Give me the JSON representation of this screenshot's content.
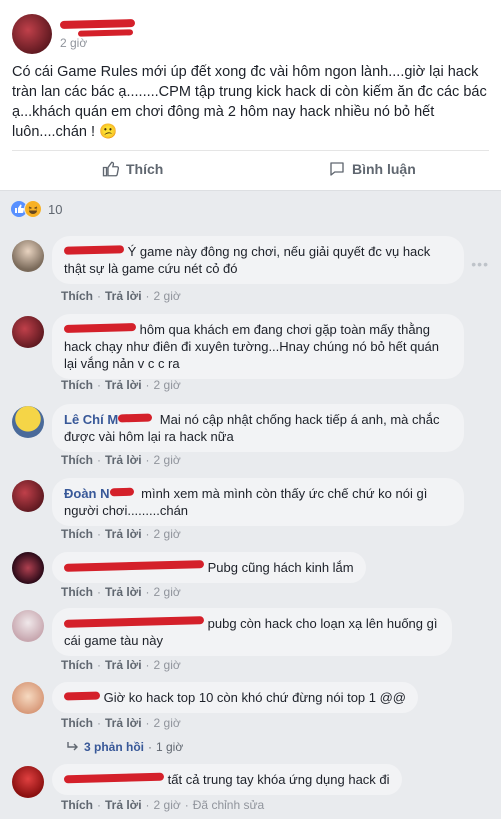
{
  "post": {
    "time": "2 giờ",
    "text": "Có cái Game Rules mới úp đết xong đc vài hôm ngon lành....giờ lại hack tràn lan các bác ạ........CPM tập trung kick hack di còn kiếm ăn đc các bác ạ...khách quán em chơi đông mà 2 hôm nay hack nhiều nó bỏ hết luôn....chán ! 😕",
    "like_label": "Thích",
    "comment_label": "Bình luận"
  },
  "reactions": {
    "count": "10"
  },
  "comments": [
    {
      "name": "",
      "text": "Ý game này đông ng chơi, nếu giải quyết đc vụ hack thật sự là game cứu nét cỏ đó",
      "like": "Thích",
      "reply": "Trả lời",
      "time": "2 giờ"
    },
    {
      "name": "",
      "text": "hôm qua khách em đang chơi gặp toàn mấy thằng hack chạy như điên đi xuyên tường...Hnay chúng nó bỏ hết quán lại vắng nản v c c ra",
      "like": "Thích",
      "reply": "Trả lời",
      "time": "2 giờ"
    },
    {
      "name": "Lê Chí M",
      "text": "Mai nó cập nhật chống hack tiếp á anh, mà chắc được vài hôm lại ra hack nữa",
      "like": "Thích",
      "reply": "Trả lời",
      "time": "2 giờ"
    },
    {
      "name": "Đoàn N",
      "text": "mình xem mà mình còn thấy ức chế chứ ko nói gì người chơi.........chán",
      "like": "Thích",
      "reply": "Trả lời",
      "time": "2 giờ"
    },
    {
      "name": "",
      "text": "Pubg cũng hách kinh lắm",
      "like": "Thích",
      "reply": "Trả lời",
      "time": "2 giờ"
    },
    {
      "name": "",
      "text": "pubg còn hack cho loạn xạ lên huống gì cái game tàu này",
      "like": "Thích",
      "reply": "Trả lời",
      "time": "2 giờ"
    },
    {
      "name": "",
      "text": "Giờ ko hack top 10 còn khó chứ đừng nói top 1 @@",
      "like": "Thích",
      "reply": "Trả lời",
      "time": "2 giờ"
    },
    {
      "name": "",
      "text": "tất cả trung tay khóa ứng dụng hack đi",
      "like": "Thích",
      "reply": "Trả lời",
      "time": "2 giờ",
      "edited": "Đã chỉnh sửa"
    }
  ],
  "replies": {
    "label": "3 phản hồi",
    "time": "1 giờ"
  },
  "colors": {
    "link": "#385898",
    "muted": "#90949c",
    "bubble": "#f2f3f5",
    "redaction": "#d4202a"
  }
}
